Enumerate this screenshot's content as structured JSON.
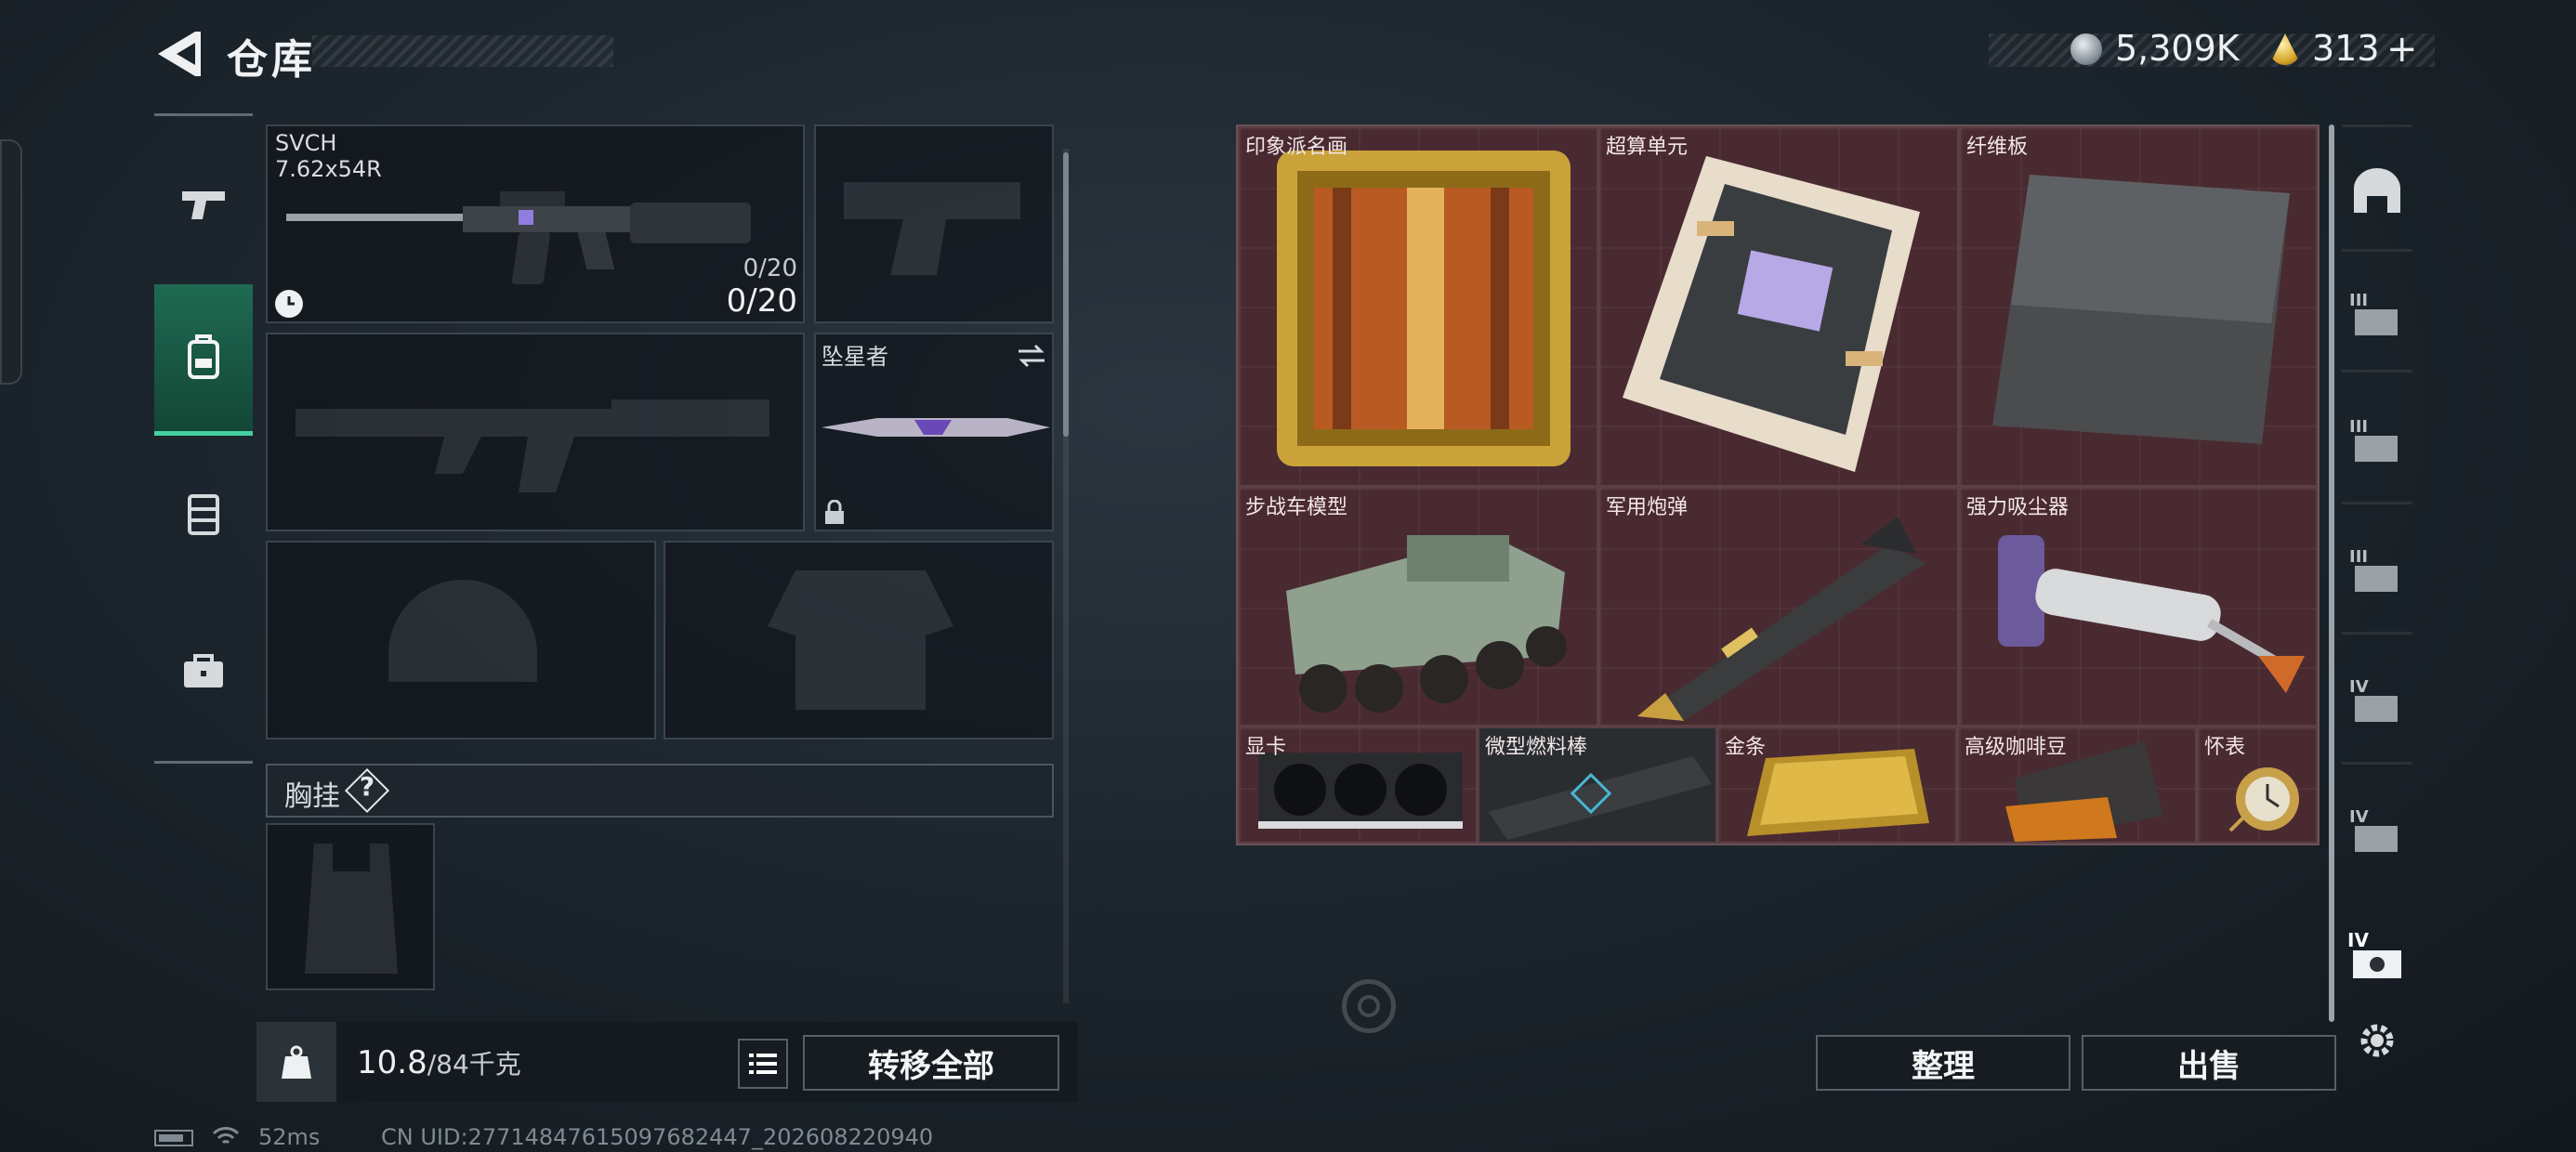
{
  "header": {
    "title": "仓库",
    "currency": {
      "silver": "5,309K",
      "gold": "313",
      "gold_plus": "+"
    }
  },
  "loadout": {
    "primary": {
      "name": "SVCH",
      "caliber": "7.62x54R",
      "ammo_small": "0/20",
      "ammo_big": "0/20"
    },
    "melee": {
      "name": "坠星者"
    },
    "chest_rig": {
      "label": "胸挂",
      "help": "?"
    }
  },
  "weight": {
    "current": "10.8",
    "max_unit": "/84千克"
  },
  "buttons": {
    "transfer_all": "转移全部",
    "organize": "整理",
    "sell": "出售"
  },
  "container_items": [
    {
      "label": "印象派名画"
    },
    {
      "label": "超算单元"
    },
    {
      "label": "纤维板"
    },
    {
      "label": "步战车模型"
    },
    {
      "label": "军用炮弹"
    },
    {
      "label": "强力吸尘器"
    },
    {
      "label": "显卡"
    },
    {
      "label": "微型燃料棒"
    },
    {
      "label": "金条"
    },
    {
      "label": "高级咖啡豆"
    },
    {
      "label": "怀表"
    }
  ],
  "right_tabs": [
    "home-vault-icon",
    "tier-iii-case-icon",
    "tier-iii-case-icon",
    "tier-iii-case-icon",
    "tier-iv-case-icon",
    "tier-iv-case-icon",
    "tier-iv-case-icon",
    "settings-icon"
  ],
  "status": {
    "ping": "52ms",
    "uid": "CN UID:27714847615097682447_202608220940"
  },
  "colors": {
    "accent": "#45d0a0",
    "grid": "#4a2a31"
  }
}
